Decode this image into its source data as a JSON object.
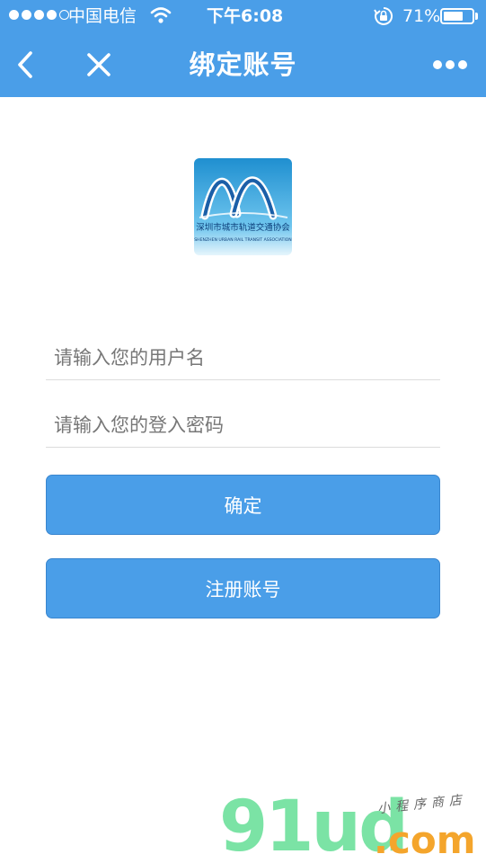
{
  "status_bar": {
    "carrier": "中国电信",
    "time": "下午6:08",
    "battery_percent_text": "71%",
    "battery_level": 0.71,
    "signal_bars": 4,
    "signal_max": 5,
    "icons": [
      "signal-dots-icon",
      "wifi-icon",
      "rotation-lock-icon",
      "battery-icon"
    ]
  },
  "nav": {
    "title": "绑定账号",
    "icons": [
      "back-arrow-icon",
      "close-icon",
      "more-dots-icon"
    ]
  },
  "logo": {
    "text_cn": "深圳市城市轨道交通协会",
    "text_en": "SHENZHEN URBAN RAIL TRANSIT ASSOCIATION"
  },
  "form": {
    "username_placeholder": "请输入您的用户名",
    "password_placeholder": "请输入您的登入密码",
    "confirm_label": "确定",
    "register_label": "注册账号"
  },
  "watermark": {
    "main": "91ud",
    "domain": ".com",
    "tagline": "小程序商店"
  },
  "colors": {
    "primary": "#4a9ee8",
    "watermark_green": "#7be3a5",
    "watermark_orange": "#f4a52c"
  }
}
